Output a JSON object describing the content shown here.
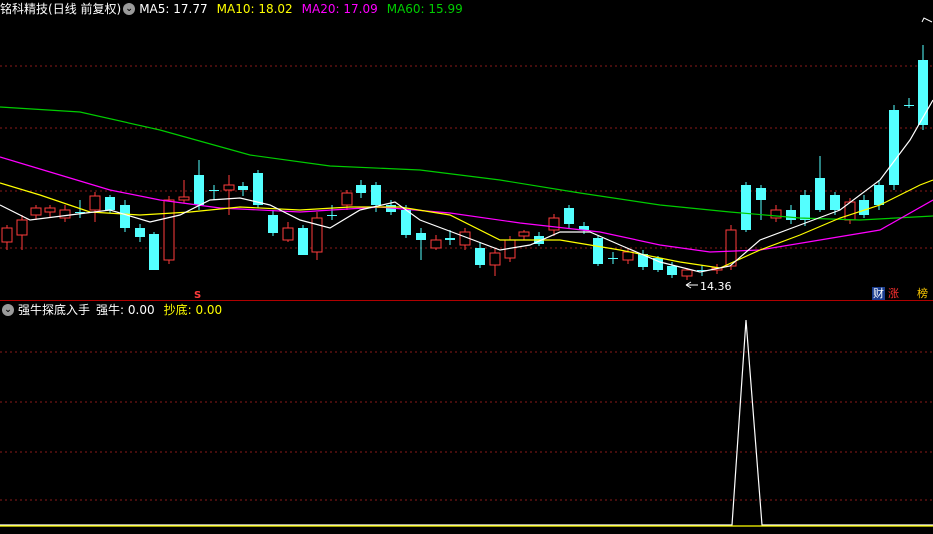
{
  "stock": {
    "name": "铭科精技",
    "period": "(日线 前复权)"
  },
  "ma_legend": [
    {
      "label": "MA5: 17.77",
      "color": "#ffffff"
    },
    {
      "label": "MA10: 18.02",
      "color": "#ffff00"
    },
    {
      "label": "MA20: 17.09",
      "color": "#ff00ff"
    },
    {
      "label": "MA60: 15.99",
      "color": "#00cc00"
    }
  ],
  "indicator": {
    "name": "强牛探底入手",
    "values": [
      {
        "label": "强牛: 0.00",
        "color": "#ffffff"
      },
      {
        "label": "抄底: 0.00",
        "color": "#ffff00"
      }
    ]
  },
  "annotations": {
    "low_price": "14.36",
    "s_marker": "S"
  },
  "badges": [
    {
      "text": "财",
      "color": "#ffffff",
      "bg": "#1a3d8f"
    },
    {
      "text": "涨",
      "color": "#ff3030",
      "bg": "#000000"
    },
    {
      "text": "榜",
      "color": "#ffcc00",
      "bg": "#000000"
    }
  ],
  "colors": {
    "up": "#ff3c3c",
    "down": "#54ffff",
    "grid": "#8a1a1a"
  }
}
